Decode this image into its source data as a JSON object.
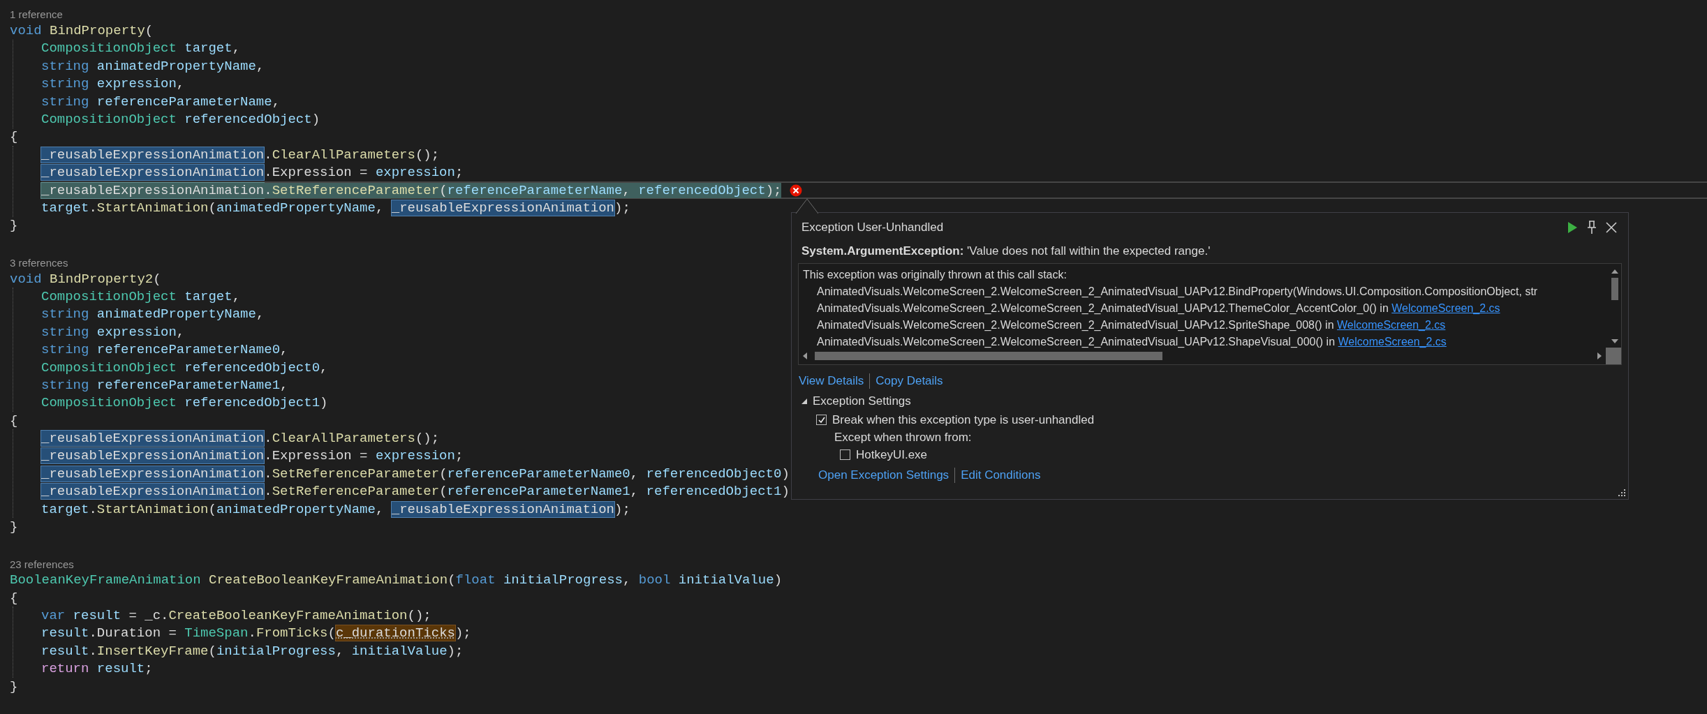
{
  "editor": {
    "lines": [
      {
        "kind": "lens",
        "text": "1 reference"
      },
      {
        "kind": "code",
        "tokens": [
          {
            "text": "void",
            "kind": "keyword"
          },
          {
            "text": " BindProperty",
            "kind": "method"
          },
          {
            "text": "(",
            "kind": "plain"
          }
        ],
        "children": [
          {
            "kind": "code",
            "tokens": [
              {
                "text": "CompositionObject",
                "kind": "type"
              },
              {
                "text": " target",
                "kind": "param"
              },
              {
                "text": ",",
                "kind": "plain"
              }
            ]
          },
          {
            "kind": "code",
            "tokens": [
              {
                "text": "string",
                "kind": "keyword"
              },
              {
                "text": " animatedPropertyName",
                "kind": "param"
              },
              {
                "text": ",",
                "kind": "plain"
              }
            ]
          },
          {
            "kind": "code",
            "tokens": [
              {
                "text": "string",
                "kind": "keyword"
              },
              {
                "text": " expression",
                "kind": "param"
              },
              {
                "text": ",",
                "kind": "plain"
              }
            ]
          },
          {
            "kind": "code",
            "tokens": [
              {
                "text": "string",
                "kind": "keyword"
              },
              {
                "text": " referenceParameterName",
                "kind": "param"
              },
              {
                "text": ",",
                "kind": "plain"
              }
            ]
          },
          {
            "kind": "code",
            "tokens": [
              {
                "text": "CompositionObject",
                "kind": "type"
              },
              {
                "text": " referencedObject",
                "kind": "param"
              },
              {
                "text": ")",
                "kind": "plain"
              }
            ]
          }
        ]
      },
      {
        "kind": "code",
        "tokens": [
          {
            "text": "{",
            "kind": "plain"
          }
        ],
        "children": [
          {
            "kind": "code",
            "tokens": [
              {
                "text": "_reusableExpressionAnimation",
                "kind": "reference-highlight"
              },
              {
                "text": ".",
                "kind": "plain"
              },
              {
                "text": "ClearAllParameters",
                "kind": "method"
              },
              {
                "text": "();",
                "kind": "plain"
              }
            ]
          },
          {
            "kind": "code",
            "tokens": [
              {
                "text": "_reusableExpressionAnimation",
                "kind": "reference-highlight"
              },
              {
                "text": ".Expression = ",
                "kind": "plain"
              },
              {
                "text": "expression",
                "kind": "param"
              },
              {
                "text": ";",
                "kind": "plain"
              }
            ]
          },
          {
            "kind": "code",
            "current": true,
            "error": true,
            "tokens": [
              {
                "text": "_reusableExpressionAnimation",
                "kind": "reference-highlight"
              },
              {
                "text": ".",
                "kind": "plain"
              },
              {
                "text": "SetReferenceParameter",
                "kind": "method"
              },
              {
                "text": "(",
                "kind": "plain"
              },
              {
                "text": "referenceParameterName",
                "kind": "param"
              },
              {
                "text": ", ",
                "kind": "plain"
              },
              {
                "text": "referencedObject",
                "kind": "param"
              },
              {
                "text": ");",
                "kind": "plain"
              }
            ]
          },
          {
            "kind": "code",
            "tokens": [
              {
                "text": "target",
                "kind": "param"
              },
              {
                "text": ".",
                "kind": "plain"
              },
              {
                "text": "StartAnimation",
                "kind": "method"
              },
              {
                "text": "(",
                "kind": "plain"
              },
              {
                "text": "animatedPropertyName",
                "kind": "param"
              },
              {
                "text": ", ",
                "kind": "plain"
              },
              {
                "text": "_reusableExpressionAnimation",
                "kind": "reference-highlight"
              },
              {
                "text": ");",
                "kind": "plain"
              }
            ]
          }
        ]
      },
      {
        "kind": "code",
        "tokens": [
          {
            "text": "}",
            "kind": "plain"
          }
        ]
      },
      {
        "kind": "blank"
      },
      {
        "kind": "lens",
        "text": "3 references"
      },
      {
        "kind": "code",
        "tokens": [
          {
            "text": "void",
            "kind": "keyword"
          },
          {
            "text": " BindProperty2",
            "kind": "method"
          },
          {
            "text": "(",
            "kind": "plain"
          }
        ],
        "children": [
          {
            "kind": "code",
            "tokens": [
              {
                "text": "CompositionObject",
                "kind": "type"
              },
              {
                "text": " target",
                "kind": "param"
              },
              {
                "text": ",",
                "kind": "plain"
              }
            ]
          },
          {
            "kind": "code",
            "tokens": [
              {
                "text": "string",
                "kind": "keyword"
              },
              {
                "text": " animatedPropertyName",
                "kind": "param"
              },
              {
                "text": ",",
                "kind": "plain"
              }
            ]
          },
          {
            "kind": "code",
            "tokens": [
              {
                "text": "string",
                "kind": "keyword"
              },
              {
                "text": " expression",
                "kind": "param"
              },
              {
                "text": ",",
                "kind": "plain"
              }
            ]
          },
          {
            "kind": "code",
            "tokens": [
              {
                "text": "string",
                "kind": "keyword"
              },
              {
                "text": " referenceParameterName0",
                "kind": "param"
              },
              {
                "text": ",",
                "kind": "plain"
              }
            ]
          },
          {
            "kind": "code",
            "tokens": [
              {
                "text": "CompositionObject",
                "kind": "type"
              },
              {
                "text": " referencedObject0",
                "kind": "param"
              },
              {
                "text": ",",
                "kind": "plain"
              }
            ]
          },
          {
            "kind": "code",
            "tokens": [
              {
                "text": "string",
                "kind": "keyword"
              },
              {
                "text": " referenceParameterName1",
                "kind": "param"
              },
              {
                "text": ",",
                "kind": "plain"
              }
            ]
          },
          {
            "kind": "code",
            "tokens": [
              {
                "text": "CompositionObject",
                "kind": "type"
              },
              {
                "text": " referencedObject1",
                "kind": "param"
              },
              {
                "text": ")",
                "kind": "plain"
              }
            ]
          }
        ]
      },
      {
        "kind": "code",
        "tokens": [
          {
            "text": "{",
            "kind": "plain"
          }
        ],
        "children": [
          {
            "kind": "code",
            "tokens": [
              {
                "text": "_reusableExpressionAnimation",
                "kind": "reference-highlight"
              },
              {
                "text": ".",
                "kind": "plain"
              },
              {
                "text": "ClearAllParameters",
                "kind": "method"
              },
              {
                "text": "();",
                "kind": "plain"
              }
            ]
          },
          {
            "kind": "code",
            "tokens": [
              {
                "text": "_reusableExpressionAnimation",
                "kind": "reference-highlight"
              },
              {
                "text": ".Expression = ",
                "kind": "plain"
              },
              {
                "text": "expression",
                "kind": "param"
              },
              {
                "text": ";",
                "kind": "plain"
              }
            ]
          },
          {
            "kind": "code",
            "tokens": [
              {
                "text": "_reusableExpressionAnimation",
                "kind": "reference-highlight"
              },
              {
                "text": ".",
                "kind": "plain"
              },
              {
                "text": "SetReferenceParameter",
                "kind": "method"
              },
              {
                "text": "(",
                "kind": "plain"
              },
              {
                "text": "referenceParameterName0",
                "kind": "param"
              },
              {
                "text": ", ",
                "kind": "plain"
              },
              {
                "text": "referencedObject0",
                "kind": "param"
              },
              {
                "text": ")",
                "kind": "plain"
              }
            ]
          },
          {
            "kind": "code",
            "tokens": [
              {
                "text": "_reusableExpressionAnimation",
                "kind": "reference-highlight"
              },
              {
                "text": ".",
                "kind": "plain"
              },
              {
                "text": "SetReferenceParameter",
                "kind": "method"
              },
              {
                "text": "(",
                "kind": "plain"
              },
              {
                "text": "referenceParameterName1",
                "kind": "param"
              },
              {
                "text": ", ",
                "kind": "plain"
              },
              {
                "text": "referencedObject1",
                "kind": "param"
              },
              {
                "text": ")",
                "kind": "plain"
              }
            ]
          },
          {
            "kind": "code",
            "tokens": [
              {
                "text": "target",
                "kind": "param"
              },
              {
                "text": ".",
                "kind": "plain"
              },
              {
                "text": "StartAnimation",
                "kind": "method"
              },
              {
                "text": "(",
                "kind": "plain"
              },
              {
                "text": "animatedPropertyName",
                "kind": "param"
              },
              {
                "text": ", ",
                "kind": "plain"
              },
              {
                "text": "_reusableExpressionAnimation",
                "kind": "reference-highlight"
              },
              {
                "text": ");",
                "kind": "plain"
              }
            ]
          }
        ]
      },
      {
        "kind": "code",
        "tokens": [
          {
            "text": "}",
            "kind": "plain"
          }
        ]
      },
      {
        "kind": "blank"
      },
      {
        "kind": "lens",
        "text": "23 references"
      },
      {
        "kind": "code",
        "tokens": [
          {
            "text": "BooleanKeyFrameAnimation",
            "kind": "type"
          },
          {
            "text": " CreateBooleanKeyFrameAnimation",
            "kind": "method"
          },
          {
            "text": "(",
            "kind": "plain"
          },
          {
            "text": "float",
            "kind": "keyword"
          },
          {
            "text": " initialProgress",
            "kind": "param"
          },
          {
            "text": ", ",
            "kind": "plain"
          },
          {
            "text": "bool",
            "kind": "keyword"
          },
          {
            "text": " initialValue",
            "kind": "param"
          },
          {
            "text": ")",
            "kind": "plain"
          }
        ]
      },
      {
        "kind": "code",
        "tokens": [
          {
            "text": "{",
            "kind": "plain"
          }
        ],
        "children": [
          {
            "kind": "code",
            "tokens": [
              {
                "text": "var",
                "kind": "keyword"
              },
              {
                "text": " result",
                "kind": "param"
              },
              {
                "text": " = _c.",
                "kind": "plain"
              },
              {
                "text": "CreateBooleanKeyFrameAnimation",
                "kind": "method"
              },
              {
                "text": "();",
                "kind": "plain"
              }
            ]
          },
          {
            "kind": "code",
            "tokens": [
              {
                "text": "result",
                "kind": "param"
              },
              {
                "text": ".Duration = ",
                "kind": "plain"
              },
              {
                "text": "TimeSpan",
                "kind": "type"
              },
              {
                "text": ".",
                "kind": "plain"
              },
              {
                "text": "FromTicks",
                "kind": "method"
              },
              {
                "text": "(",
                "kind": "plain"
              },
              {
                "text": "c_durationTicks",
                "kind": "suggestion-highlight"
              },
              {
                "text": ");",
                "kind": "plain"
              }
            ]
          },
          {
            "kind": "code",
            "tokens": [
              {
                "text": "result",
                "kind": "param"
              },
              {
                "text": ".",
                "kind": "plain"
              },
              {
                "text": "InsertKeyFrame",
                "kind": "method"
              },
              {
                "text": "(",
                "kind": "plain"
              },
              {
                "text": "initialProgress",
                "kind": "param"
              },
              {
                "text": ", ",
                "kind": "plain"
              },
              {
                "text": "initialValue",
                "kind": "param"
              },
              {
                "text": ");",
                "kind": "plain"
              }
            ]
          },
          {
            "kind": "code",
            "tokens": [
              {
                "text": "return",
                "kind": "control"
              },
              {
                "text": " result",
                "kind": "param"
              },
              {
                "text": ";",
                "kind": "plain"
              }
            ]
          }
        ]
      },
      {
        "kind": "code",
        "tokens": [
          {
            "text": "}",
            "kind": "plain"
          }
        ]
      }
    ]
  },
  "exception_popup": {
    "title": "Exception User-Unhandled",
    "message": "**System.ArgumentException:** 'Value does not fall within the expected range.'",
    "stack_header": "This exception was originally thrown at this call stack:",
    "stack_frames": [
      {
        "text": "AnimatedVisuals.WelcomeScreen_2.WelcomeScreen_2_AnimatedVisual_UAPv12.BindProperty(Windows.UI.Composition.CompositionObject, str"
      },
      {
        "text": "AnimatedVisuals.WelcomeScreen_2.WelcomeScreen_2_AnimatedVisual_UAPv12.ThemeColor_AccentColor_0() in",
        "file_link": "WelcomeScreen_2.cs"
      },
      {
        "text": "AnimatedVisuals.WelcomeScreen_2.WelcomeScreen_2_AnimatedVisual_UAPv12.SpriteShape_008() in",
        "file_link": "WelcomeScreen_2.cs"
      },
      {
        "text": "AnimatedVisuals.WelcomeScreen_2.WelcomeScreen_2_AnimatedVisual_UAPv12.ShapeVisual_000() in",
        "file_link": "WelcomeScreen_2.cs"
      }
    ],
    "links": [
      "View Details",
      "Copy Details"
    ],
    "settings": {
      "title": "Exception Settings",
      "expanded": true,
      "break_option": {
        "label": "Break when this exception type is user-unhandled",
        "checked": true
      },
      "except_label": "Except when thrown from:",
      "modules": [
        {
          "label": "HotkeyUI.exe",
          "checked": false
        }
      ],
      "links": [
        "Open Exception Settings",
        "Edit Conditions"
      ]
    }
  }
}
